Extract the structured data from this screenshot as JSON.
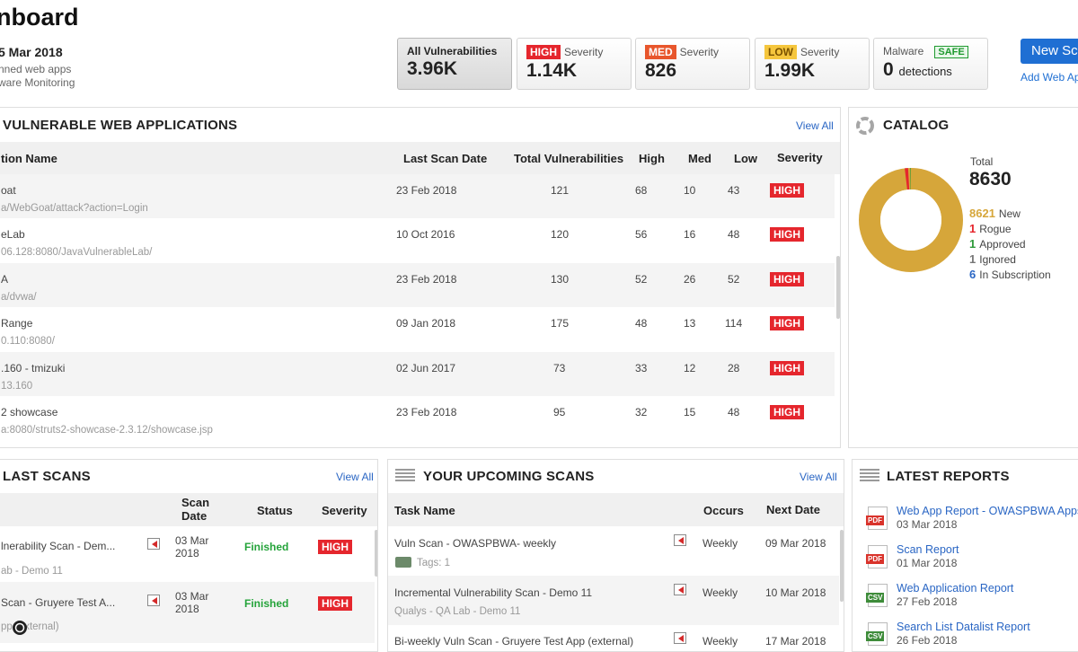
{
  "header": {
    "title": "nboard",
    "date": "5 Mar 2018",
    "sub1": "nned web apps",
    "sub2": "ware Monitoring"
  },
  "stats": {
    "all": {
      "label": "All Vulnerabilities",
      "value": "3.96K"
    },
    "high": {
      "tag": "HIGH",
      "label": "Severity",
      "value": "1.14K"
    },
    "med": {
      "tag": "MED",
      "label": "Severity",
      "value": "826"
    },
    "low": {
      "tag": "LOW",
      "label": "Severity",
      "value": "1.99K"
    },
    "malware": {
      "label": "Malware",
      "safe": "SAFE",
      "value": "0",
      "unit": "detections"
    }
  },
  "actions": {
    "new_scan": "New Sca",
    "add_web": "Add Web Ap"
  },
  "vuln_apps": {
    "title": "VULNERABLE WEB APPLICATIONS",
    "view_all": "View All",
    "columns": [
      "tion Name",
      "Last Scan Date",
      "Total Vulnerabilities",
      "High",
      "Med",
      "Low",
      "Severity"
    ],
    "rows": [
      {
        "name": "oat",
        "url": "a/WebGoat/attack?action=Login",
        "date": "23 Feb 2018",
        "total": "121",
        "high": "68",
        "med": "10",
        "low": "43",
        "sev": "HIGH"
      },
      {
        "name": "eLab",
        "url": "06.128:8080/JavaVulnerableLab/",
        "date": "10 Oct 2016",
        "total": "120",
        "high": "56",
        "med": "16",
        "low": "48",
        "sev": "HIGH"
      },
      {
        "name": "A",
        "url": "a/dvwa/",
        "date": "23 Feb 2018",
        "total": "130",
        "high": "52",
        "med": "26",
        "low": "52",
        "sev": "HIGH"
      },
      {
        "name": "Range",
        "url": "0.110:8080/",
        "date": "09 Jan 2018",
        "total": "175",
        "high": "48",
        "med": "13",
        "low": "114",
        "sev": "HIGH"
      },
      {
        "name": ".160 - tmizuki",
        "url": "13.160",
        "date": "02 Jun 2017",
        "total": "73",
        "high": "33",
        "med": "12",
        "low": "28",
        "sev": "HIGH"
      },
      {
        "name": "2 showcase",
        "url": "a:8080/struts2-showcase-2.3.12/showcase.jsp",
        "date": "23 Feb 2018",
        "total": "95",
        "high": "32",
        "med": "15",
        "low": "48",
        "sev": "HIGH"
      }
    ]
  },
  "catalog": {
    "title": "CATALOG",
    "total_label": "Total",
    "total": "8630",
    "legend": [
      {
        "count": "8621",
        "label": "New",
        "color": "#d6a63a"
      },
      {
        "count": "1",
        "label": "Rogue",
        "color": "#e5262d"
      },
      {
        "count": "1",
        "label": "Approved",
        "color": "#2e9a3a"
      },
      {
        "count": "1",
        "label": "Ignored",
        "color": "#777777"
      },
      {
        "count": "6",
        "label": "In Subscription",
        "color": "#2a66c4"
      }
    ]
  },
  "last_scans": {
    "title": "LAST SCANS",
    "view_all": "View All",
    "columns": {
      "scan_date_1": "Scan",
      "scan_date_2": "Date",
      "status": "Status",
      "severity": "Severity"
    },
    "rows": [
      {
        "name": "lnerability Scan - Dem...",
        "sub": "ab - Demo 11",
        "date1": "03 Mar",
        "date2": "2018",
        "status": "Finished",
        "sev": "HIGH"
      },
      {
        "name": "Scan - Gruyere Test A...",
        "sub": "pp (external)",
        "date1": "03 Mar",
        "date2": "2018",
        "status": "Finished",
        "sev": "HIGH"
      }
    ]
  },
  "upcoming": {
    "title": "YOUR UPCOMING SCANS",
    "view_all": "View All",
    "columns": {
      "task": "Task Name",
      "occurs": "Occurs",
      "next": "Next Date"
    },
    "rows": [
      {
        "name": "Vuln Scan - OWASPBWA- weekly",
        "sub": "Tags: 1",
        "occurs": "Weekly",
        "next": "09 Mar 2018"
      },
      {
        "name": "Incremental Vulnerability Scan - Demo 11",
        "sub": "Qualys - QA Lab - Demo 11",
        "occurs": "Weekly",
        "next": "10 Mar 2018"
      },
      {
        "name": "Bi-weekly Vuln Scan - Gruyere Test App (external)",
        "sub": "",
        "occurs": "Weekly",
        "next": "17 Mar 2018"
      }
    ]
  },
  "reports": {
    "title": "LATEST REPORTS",
    "items": [
      {
        "type": "PDF",
        "name": "Web App Report - OWASPBWA Apps",
        "date": "03 Mar 2018"
      },
      {
        "type": "PDF",
        "name": "Scan Report",
        "date": "01 Mar 2018"
      },
      {
        "type": "CSV",
        "name": "Web Application Report",
        "date": "27 Feb 2018"
      },
      {
        "type": "CSV",
        "name": "Search List Datalist Report",
        "date": "26 Feb 2018"
      }
    ]
  }
}
